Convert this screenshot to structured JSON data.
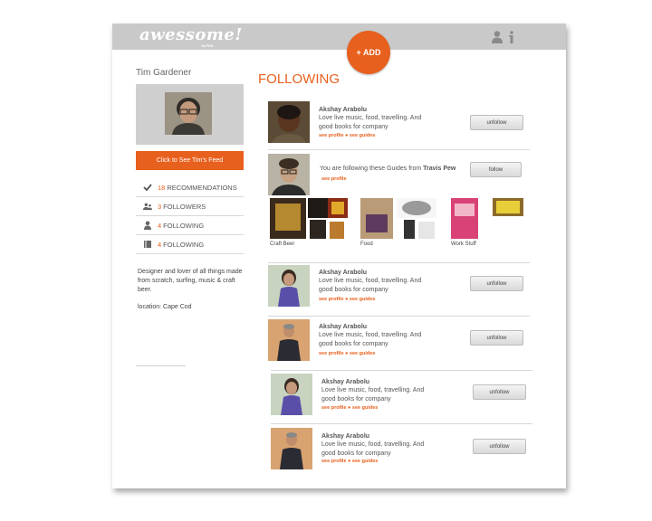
{
  "app": {
    "logo": "awessome!",
    "logo_sub": "ALPHA"
  },
  "header": {
    "add_label": "+ ADD",
    "icons": [
      "user-icon",
      "info-icon"
    ]
  },
  "profile": {
    "name": "Tim Gardener",
    "feed_button": "Click to See Tim's Feed",
    "stats": [
      {
        "icon": "checkmark-icon",
        "count": "18",
        "label": "RECOMMENDATIONS"
      },
      {
        "icon": "followers-icon",
        "count": "3",
        "label": "FOLLOWERS"
      },
      {
        "icon": "person-icon",
        "count": "4",
        "label": "FOLLOWING"
      },
      {
        "icon": "book-icon",
        "count": "4",
        "label": "FOLLOWING"
      }
    ],
    "bio": "Designer and lover of all things made from scratch, surfing, music & craft beer.",
    "location": "location: Cape Cod"
  },
  "main": {
    "title": "FOLLOWING",
    "entries": [
      {
        "name": "Akshay Arabolu",
        "desc": "Love live music, food, travelling. And good books for company",
        "see_profile": "see profile",
        "bullet": "●",
        "see_guides": "see guides",
        "button": "unfollow"
      },
      {
        "name": "Akshay Arabolu",
        "desc": "Love live music, food, travelling. And good books for company",
        "see_profile": "see profile",
        "bullet": "●",
        "see_guides": "see guides",
        "button": "unfollow"
      },
      {
        "name": "Akshay Arabolu",
        "desc": "Love live music, food, travelling. And good books for company",
        "see_profile": "see profile",
        "bullet": "●",
        "see_guides": "see guides",
        "button": "unfollow"
      },
      {
        "name": "Akshay Arabolu",
        "desc": "Love live music, food, travelling. And good books for company",
        "see_profile": "see profile",
        "bullet": "●",
        "see_guides": "see guides",
        "button": "unfollow"
      },
      {
        "name": "Akshay Arabolu",
        "desc": "Love live music, food, travelling. And good books for company",
        "see_profile": "see profile",
        "bullet": "●",
        "see_guides": "see guides",
        "button": "unfollow"
      }
    ],
    "guides_entry": {
      "text": "You are following these Guides from",
      "person": "Travis Pew",
      "see_profile": "see profile",
      "button": "follow",
      "guides": [
        "Craft Beer",
        "Food",
        "Work Stuff"
      ]
    }
  },
  "colors": {
    "accent": "#e8601d",
    "topbar": "#c9c9c9"
  }
}
